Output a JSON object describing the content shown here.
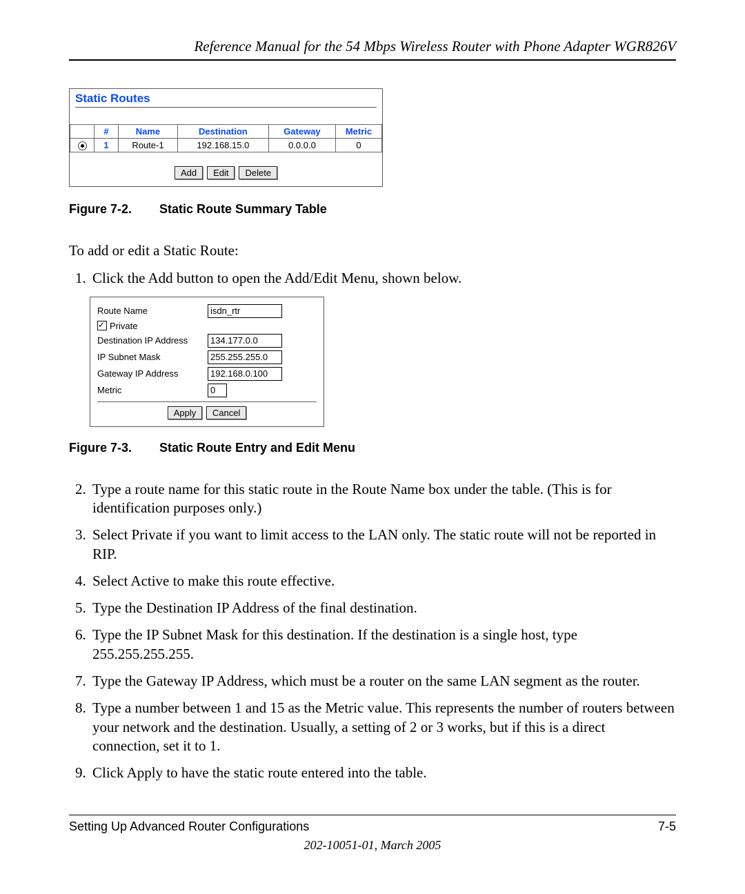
{
  "header": {
    "running": "Reference Manual for the 54 Mbps Wireless Router with Phone Adapter WGR826V"
  },
  "figure7_2": {
    "panelTitle": "Static Routes",
    "cols": {
      "radio": "",
      "num": "#",
      "name": "Name",
      "dest": "Destination",
      "gw": "Gateway",
      "metric": "Metric"
    },
    "row": {
      "num": "1",
      "name": "Route-1",
      "dest": "192.168.15.0",
      "gw": "0.0.0.0",
      "metric": "0"
    },
    "buttons": {
      "add": "Add",
      "edit": "Edit",
      "delete": "Delete"
    },
    "captionNum": "Figure 7-2.",
    "captionText": "Static Route Summary Table"
  },
  "intro": "To add or edit a Static Route:",
  "step1": "Click the Add button to open the Add/Edit Menu, shown below.",
  "figure7_3": {
    "labels": {
      "routeName": "Route Name",
      "private": "Private",
      "destIp": "Destination IP Address",
      "mask": "IP Subnet Mask",
      "gwIp": "Gateway IP Address",
      "metric": "Metric"
    },
    "values": {
      "routeName": "isdn_rtr",
      "destIp": "134.177.0.0",
      "mask": "255.255.255.0",
      "gwIp": "192.168.0.100",
      "metric": "0"
    },
    "buttons": {
      "apply": "Apply",
      "cancel": "Cancel"
    },
    "captionNum": "Figure 7-3.",
    "captionText": "Static Route Entry and Edit Menu"
  },
  "steps": {
    "s2": "Type a route name for this static route in the Route Name box under the table. (This is for identification purposes only.)",
    "s3": "Select Private if you want to limit access to the LAN only. The static route will not be reported in RIP.",
    "s4": "Select Active to make this route effective.",
    "s5": "Type the Destination IP Address of the final destination.",
    "s6": "Type the IP Subnet Mask for this destination. If the destination is a single host, type 255.255.255.255.",
    "s7": "Type the Gateway IP Address, which must be a router on the same LAN segment as the router.",
    "s8": "Type a number between 1 and 15 as the Metric value. This represents the number of routers between your network and the destination. Usually, a setting of 2 or 3 works, but if this is a direct connection, set it to 1.",
    "s9": "Click Apply to have the static route entered into the table."
  },
  "footer": {
    "left": "Setting Up Advanced Router Configurations",
    "right": "7-5",
    "date": "202-10051-01, March 2005"
  }
}
